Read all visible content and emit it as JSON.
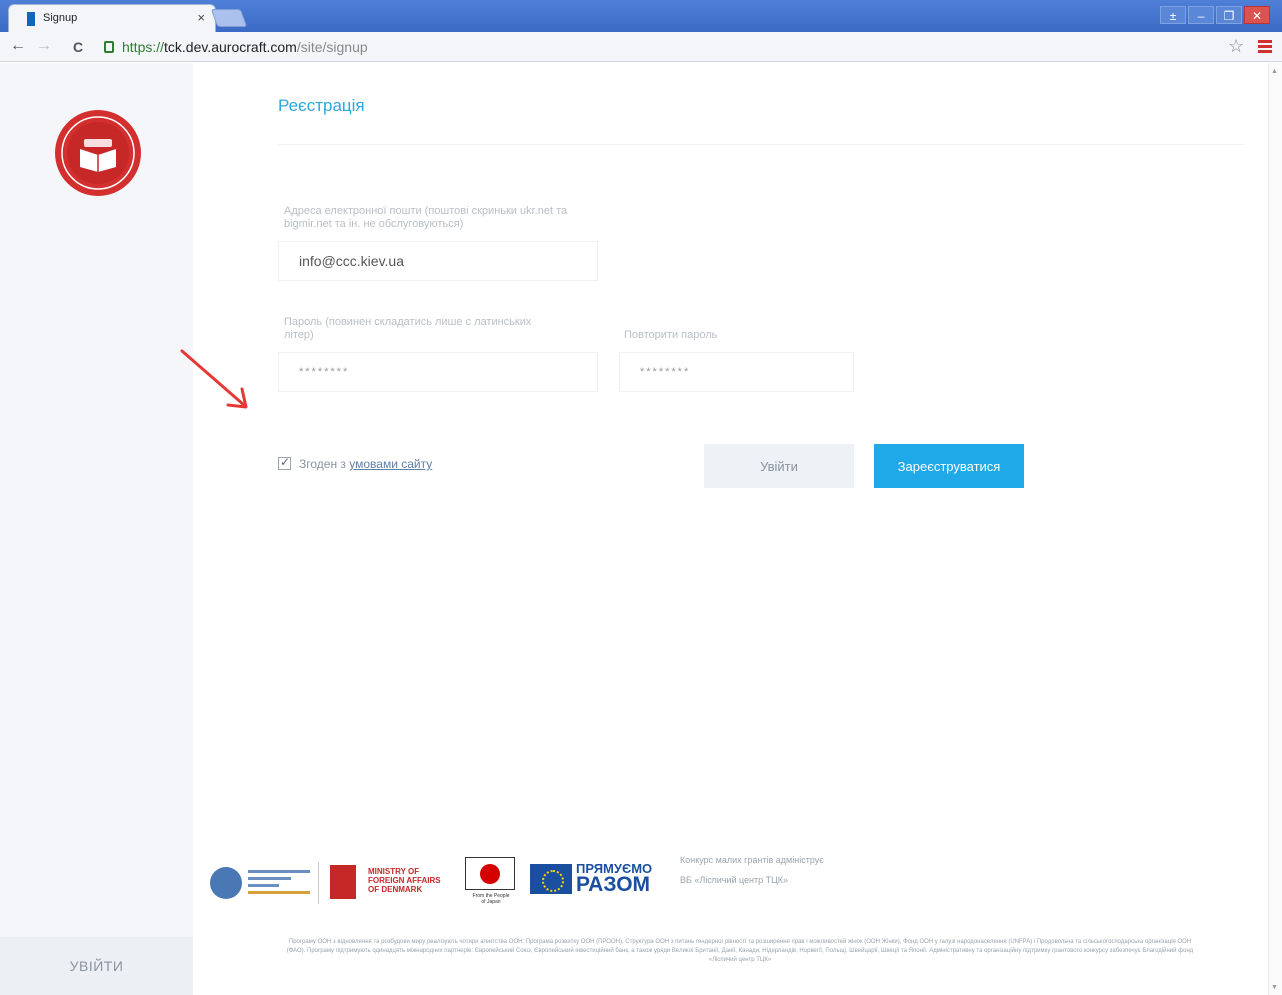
{
  "browser": {
    "tab_title": "Signup",
    "tab_close": "×",
    "url_scheme": "https://",
    "url_host": "tck.dev.aurocraft.com",
    "url_path": "/site/signup",
    "window_controls": [
      "±",
      "–",
      "❐",
      "✕"
    ],
    "nav": {
      "back": "←",
      "forward": "→",
      "reload": "C"
    },
    "star": "☆"
  },
  "page": {
    "title": "Реєстрація",
    "form": {
      "email_label": "Адреса електронної пошти (поштові скриньки ukr.net та bigmir.net та ін. не обслуговуються)",
      "email_value": "info@ccc.kiev.ua",
      "password_label": "Пароль (повинен складатись лише с латинських літер)",
      "password_value": "********",
      "repeat_password_label": "Повторити пароль",
      "repeat_password_value": "********",
      "agree_prefix": "Згоден з",
      "agree_link": "умовами сайту",
      "login_button": "Увійти",
      "register_button": "Зареєструватися"
    }
  },
  "sidebar": {
    "login": "УВІЙТИ"
  },
  "footer": {
    "denmark_text": "MINISTRY OF FOREIGN AFFAIRS OF DENMARK",
    "japan_caption": "From the People of Japan",
    "pryamuemo": "ПРЯМУЄМО",
    "razom": "РАЗОМ",
    "contest_text": "Конкурс малих грантів адмініструє ВБ «Ліспичий центр ТЦК»",
    "disclaimer": "Програму ООН з відновлення та розбудови миру реалізують чотири агентства ООН: Програма розвитку ООН (ПРООН), Структура ООН з питань гендерної рівності та розширення прав і можливостей жінок (ООН Жінки), Фонд ООН у галузі народонаселення (UNFPA) і Продовольча та сільськогосподарська організація ООН (ФАО). Програму підтримують одинадцять міжнародних партнерів: Європейський Союз, Європейський інвестиційний банк, а також уряди Великої Британії, Данії, Канади, Нідерландів, Норвегії, Польщі, Швейцарії, Швеції та Японії. Адміністративну та організаційну підтримку грантового конкурсу забезпечує Благодійний фонд «Ліспичий центр ТЦК»"
  },
  "colors": {
    "accent": "#1fa9e8",
    "heading": "#29a8e0",
    "logo_red": "#d32f2f",
    "arrow_red": "#e53935"
  }
}
